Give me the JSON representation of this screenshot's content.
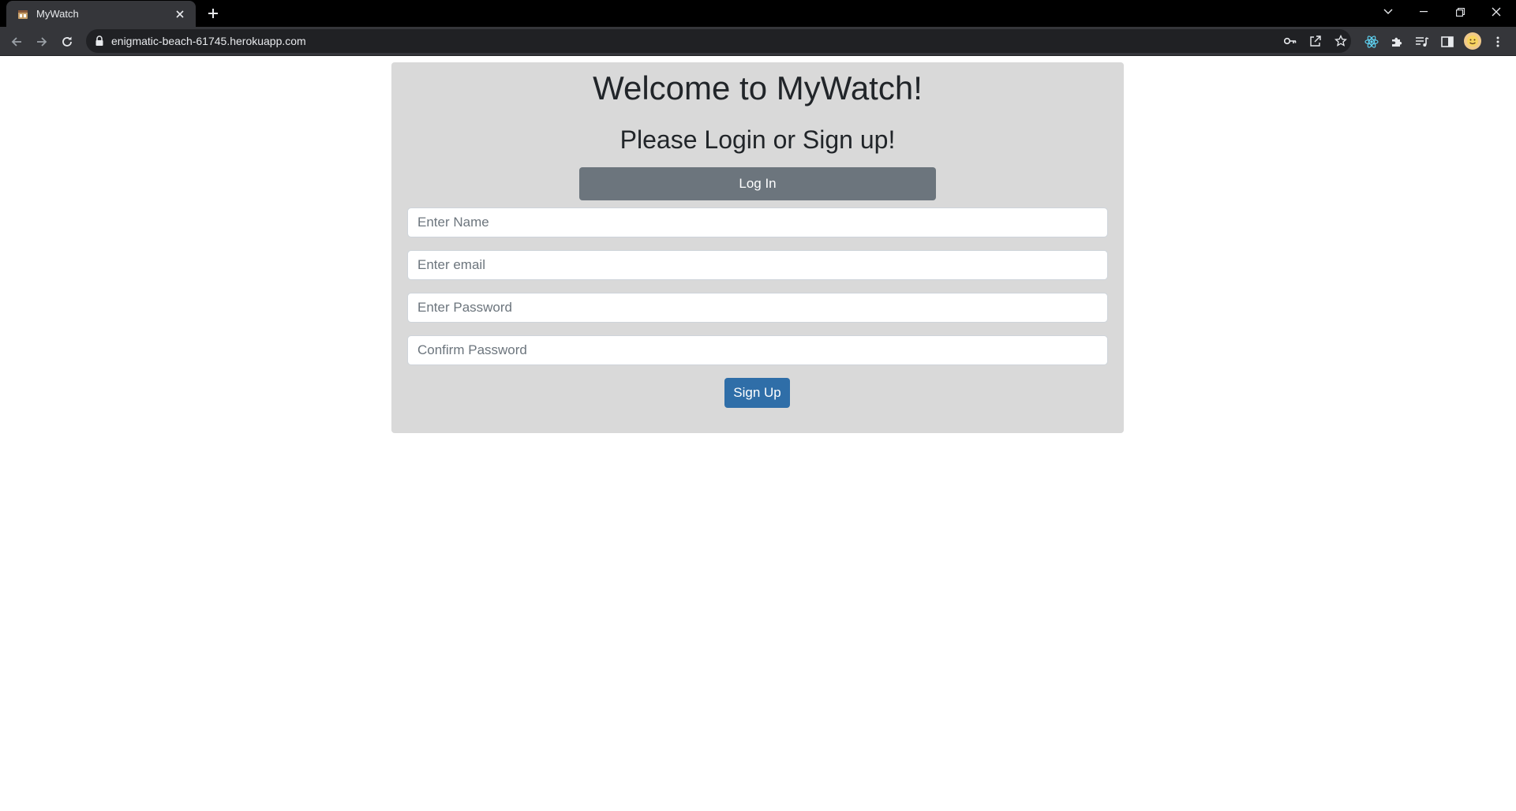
{
  "browser": {
    "tab_title": "MyWatch",
    "url": "enigmatic-beach-61745.herokuapp.com"
  },
  "page": {
    "heading": "Welcome to MyWatch!",
    "subheading": "Please Login or Sign up!",
    "login_button": "Log In",
    "name_placeholder": "Enter Name",
    "email_placeholder": "Enter email",
    "password_placeholder": "Enter Password",
    "confirm_placeholder": "Confirm Password",
    "signup_button": "Sign Up"
  },
  "colors": {
    "card_bg": "#d9d9d9",
    "login_button": "#6c757d",
    "signup_button": "#2f6ea8"
  },
  "icons": [
    "film-icon",
    "close-icon",
    "plus-icon",
    "chevron-down-icon",
    "minimize-icon",
    "restore-icon",
    "close-window-icon",
    "back-arrow-icon",
    "forward-arrow-icon",
    "reload-icon",
    "lock-icon",
    "key-icon",
    "share-icon",
    "star-icon",
    "react-icon",
    "puzzle-icon",
    "media-icon",
    "sidebar-icon",
    "avatar",
    "kebab-menu-icon"
  ]
}
